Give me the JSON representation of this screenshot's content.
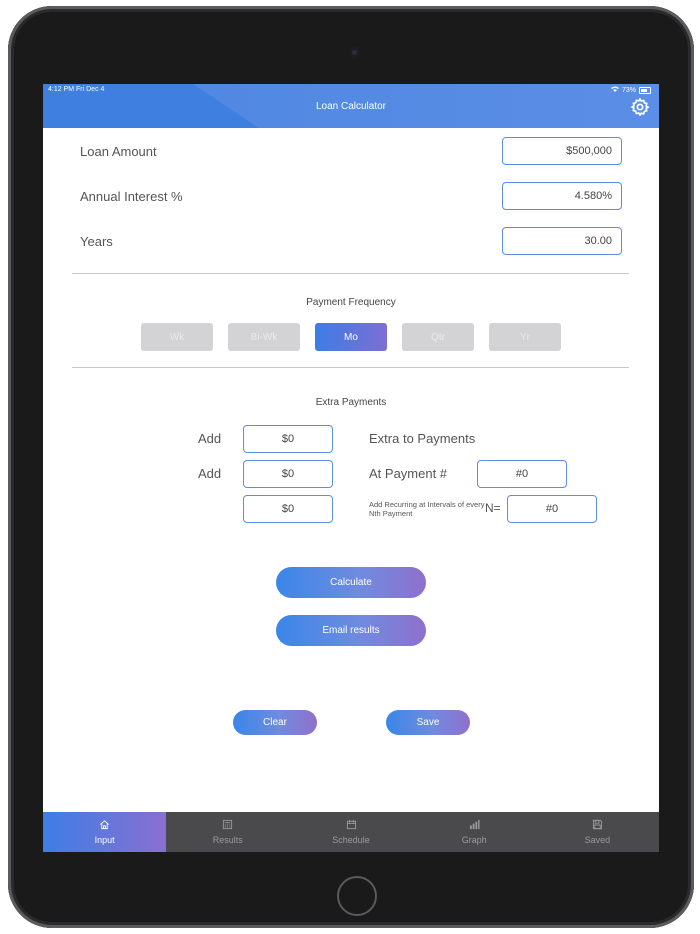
{
  "status": {
    "time": "4:12 PM  Fri Dec 4",
    "battery": "73%"
  },
  "header": {
    "title": "Loan Calculator"
  },
  "inputs": {
    "loan_amount_label": "Loan Amount",
    "loan_amount_value": "$500,000",
    "interest_label": "Annual Interest %",
    "interest_value": "4.580%",
    "years_label": "Years",
    "years_value": "30.00"
  },
  "frequency": {
    "title": "Payment Frequency",
    "options": [
      "Wk",
      "Bi-Wk",
      "Mo",
      "Qtr",
      "Yr"
    ],
    "selected": "Mo"
  },
  "extra": {
    "title": "Extra Payments",
    "add_label_1": "Add",
    "add_value_1": "$0",
    "extra_to_payments": "Extra to Payments",
    "add_label_2": "Add",
    "add_value_2": "$0",
    "at_payment_label": "At Payment #",
    "at_payment_value": "#0",
    "add_value_3": "$0",
    "recurring_note": "Add Recurring at Intervals of every Nth Payment",
    "n_label": "N=",
    "n_value": "#0"
  },
  "actions": {
    "calculate": "Calculate",
    "email": "Email results",
    "clear": "Clear",
    "save": "Save"
  },
  "tabs": [
    {
      "label": "Input",
      "icon": "home-icon",
      "active": true
    },
    {
      "label": "Results",
      "icon": "calculator-icon",
      "active": false
    },
    {
      "label": "Schedule",
      "icon": "calendar-icon",
      "active": false
    },
    {
      "label": "Graph",
      "icon": "bar-chart-icon",
      "active": false
    },
    {
      "label": "Saved",
      "icon": "floppy-disk-icon",
      "active": false
    }
  ]
}
